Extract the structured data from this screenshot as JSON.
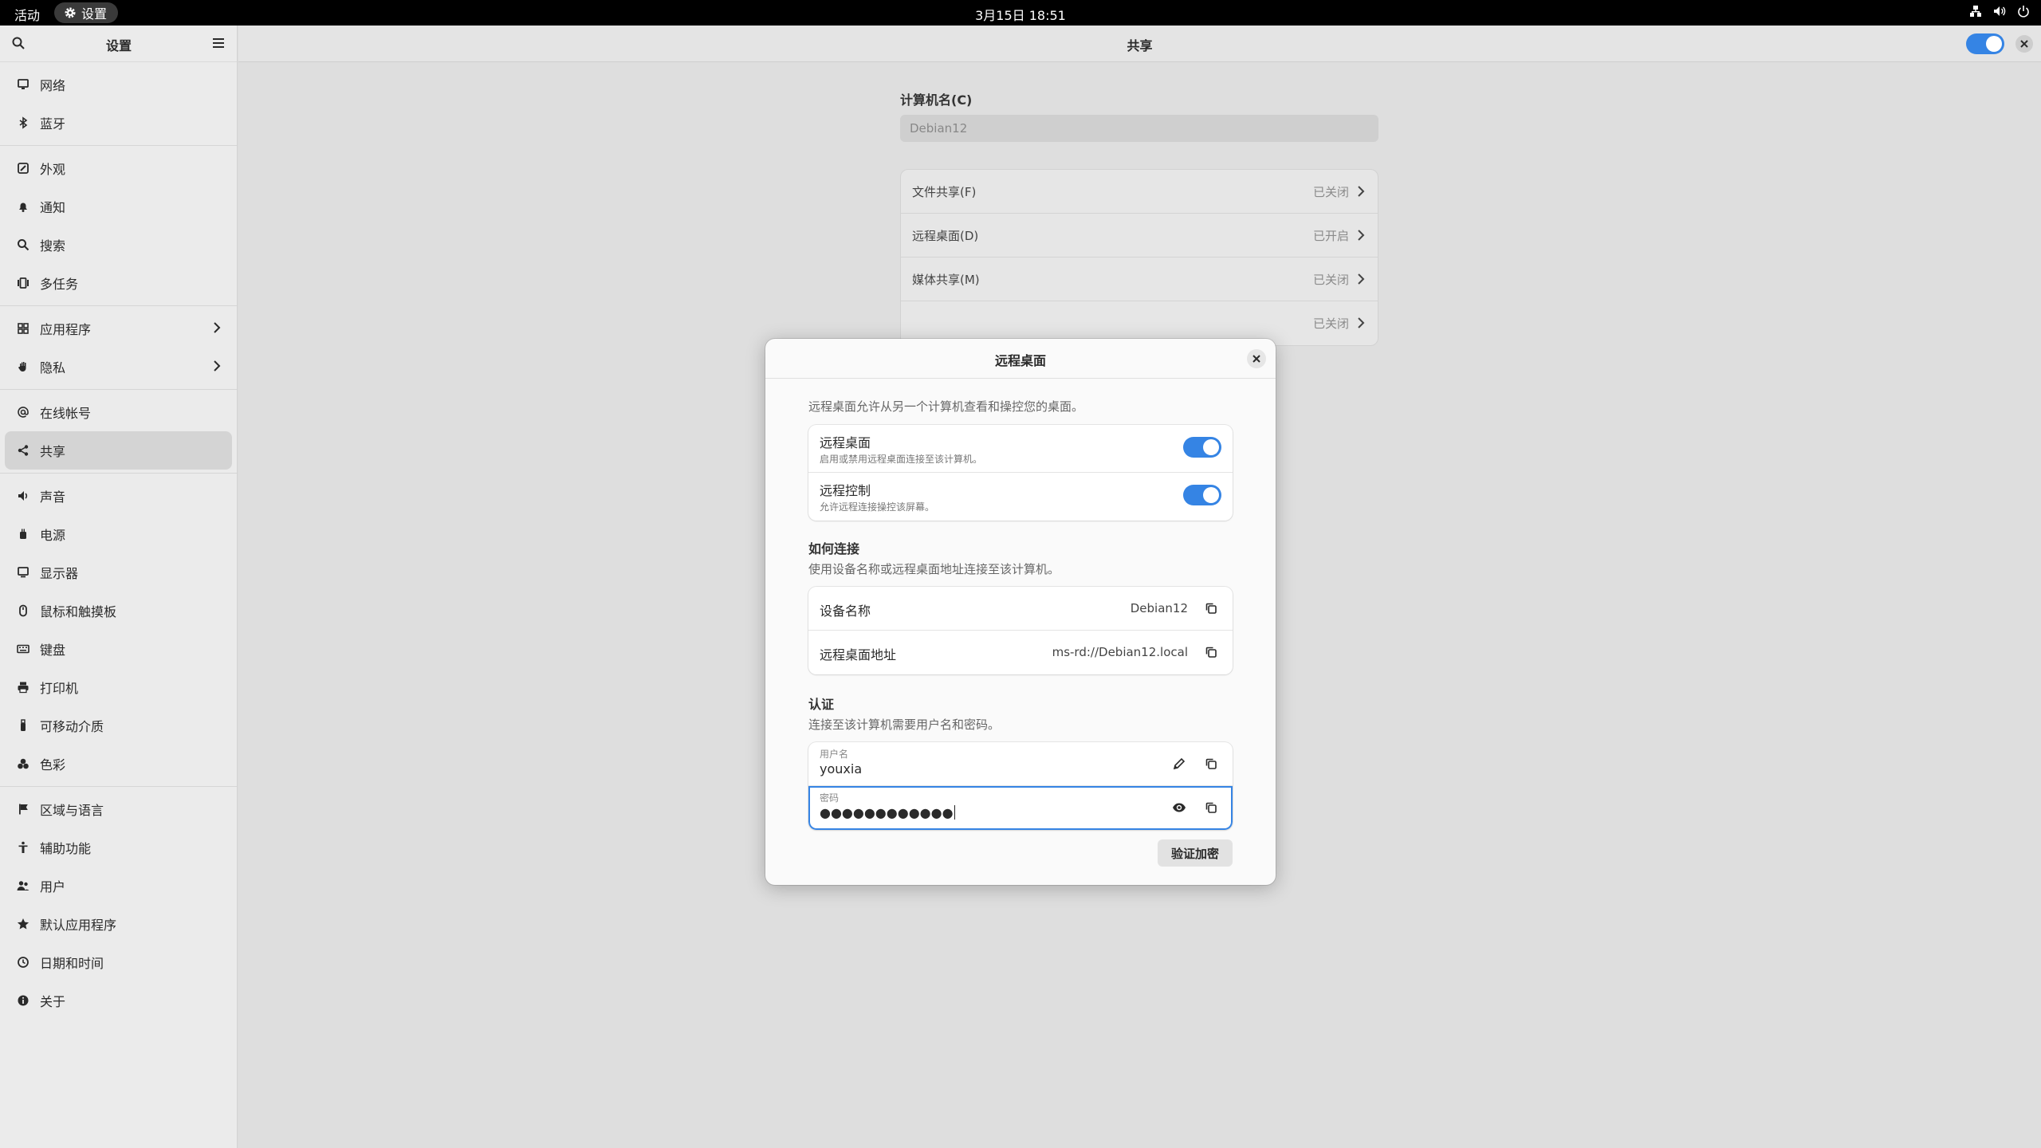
{
  "topbar": {
    "activities": "活动",
    "app_name": "设置",
    "clock": "3月15日 18:51",
    "tray_icons": [
      "network-icon",
      "volume-icon",
      "power-icon"
    ]
  },
  "sidebar": {
    "title": "设置",
    "groups": [
      [
        {
          "label": "网络",
          "icon": "network-icon"
        },
        {
          "label": "蓝牙",
          "icon": "bluetooth-icon"
        }
      ],
      [
        {
          "label": "外观",
          "icon": "appearance-icon"
        },
        {
          "label": "通知",
          "icon": "bell-icon"
        },
        {
          "label": "搜索",
          "icon": "search-icon"
        },
        {
          "label": "多任务",
          "icon": "multitask-icon"
        }
      ],
      [
        {
          "label": "应用程序",
          "icon": "apps-icon",
          "chevron": true
        },
        {
          "label": "隐私",
          "icon": "hand-icon",
          "chevron": true
        }
      ],
      [
        {
          "label": "在线帐号",
          "icon": "at-icon"
        },
        {
          "label": "共享",
          "icon": "share-icon",
          "active": true
        }
      ],
      [
        {
          "label": "声音",
          "icon": "sound-icon"
        },
        {
          "label": "电源",
          "icon": "power-icon"
        },
        {
          "label": "显示器",
          "icon": "display-icon"
        },
        {
          "label": "鼠标和触摸板",
          "icon": "mouse-icon"
        },
        {
          "label": "键盘",
          "icon": "keyboard-icon"
        },
        {
          "label": "打印机",
          "icon": "printer-icon"
        },
        {
          "label": "可移动介质",
          "icon": "usb-icon"
        },
        {
          "label": "色彩",
          "icon": "color-icon"
        }
      ],
      [
        {
          "label": "区域与语言",
          "icon": "flag-icon"
        },
        {
          "label": "辅助功能",
          "icon": "accessibility-icon"
        },
        {
          "label": "用户",
          "icon": "users-icon"
        },
        {
          "label": "默认应用程序",
          "icon": "star-icon"
        },
        {
          "label": "日期和时间",
          "icon": "clock-icon"
        },
        {
          "label": "关于",
          "icon": "info-icon"
        }
      ]
    ]
  },
  "content": {
    "title": "共享",
    "computer_name_label": "计算机名(C)",
    "computer_name_value": "Debian12",
    "share_rows": [
      {
        "label": "文件共享(F)",
        "status": "已关闭"
      },
      {
        "label": "远程桌面(D)",
        "status": "已开启"
      },
      {
        "label": "媒体共享(M)",
        "status": "已关闭"
      },
      {
        "label": "",
        "status": "已关闭"
      }
    ]
  },
  "dialog": {
    "title": "远程桌面",
    "description": "远程桌面允许从另一个计算机查看和操控您的桌面。",
    "toggles": [
      {
        "title": "远程桌面",
        "subtitle": "启用或禁用远程桌面连接至该计算机。",
        "on": true
      },
      {
        "title": "远程控制",
        "subtitle": "允许远程连接操控该屏幕。",
        "on": true
      }
    ],
    "how_heading": "如何连接",
    "how_text": "使用设备名称或远程桌面地址连接至该计算机。",
    "device_name_label": "设备名称",
    "device_name_value": "Debian12",
    "address_label": "远程桌面地址",
    "address_value": "ms-rd://Debian12.local",
    "auth_heading": "认证",
    "auth_text": "连接至该计算机需要用户名和密码。",
    "username_label": "用户名",
    "username_value": "youxia",
    "password_label": "密码",
    "password_value": "●●●●●●●●●●●●",
    "verify_button": "验证加密"
  },
  "colors": {
    "accent": "#3584e4",
    "topbar": "#000000"
  }
}
